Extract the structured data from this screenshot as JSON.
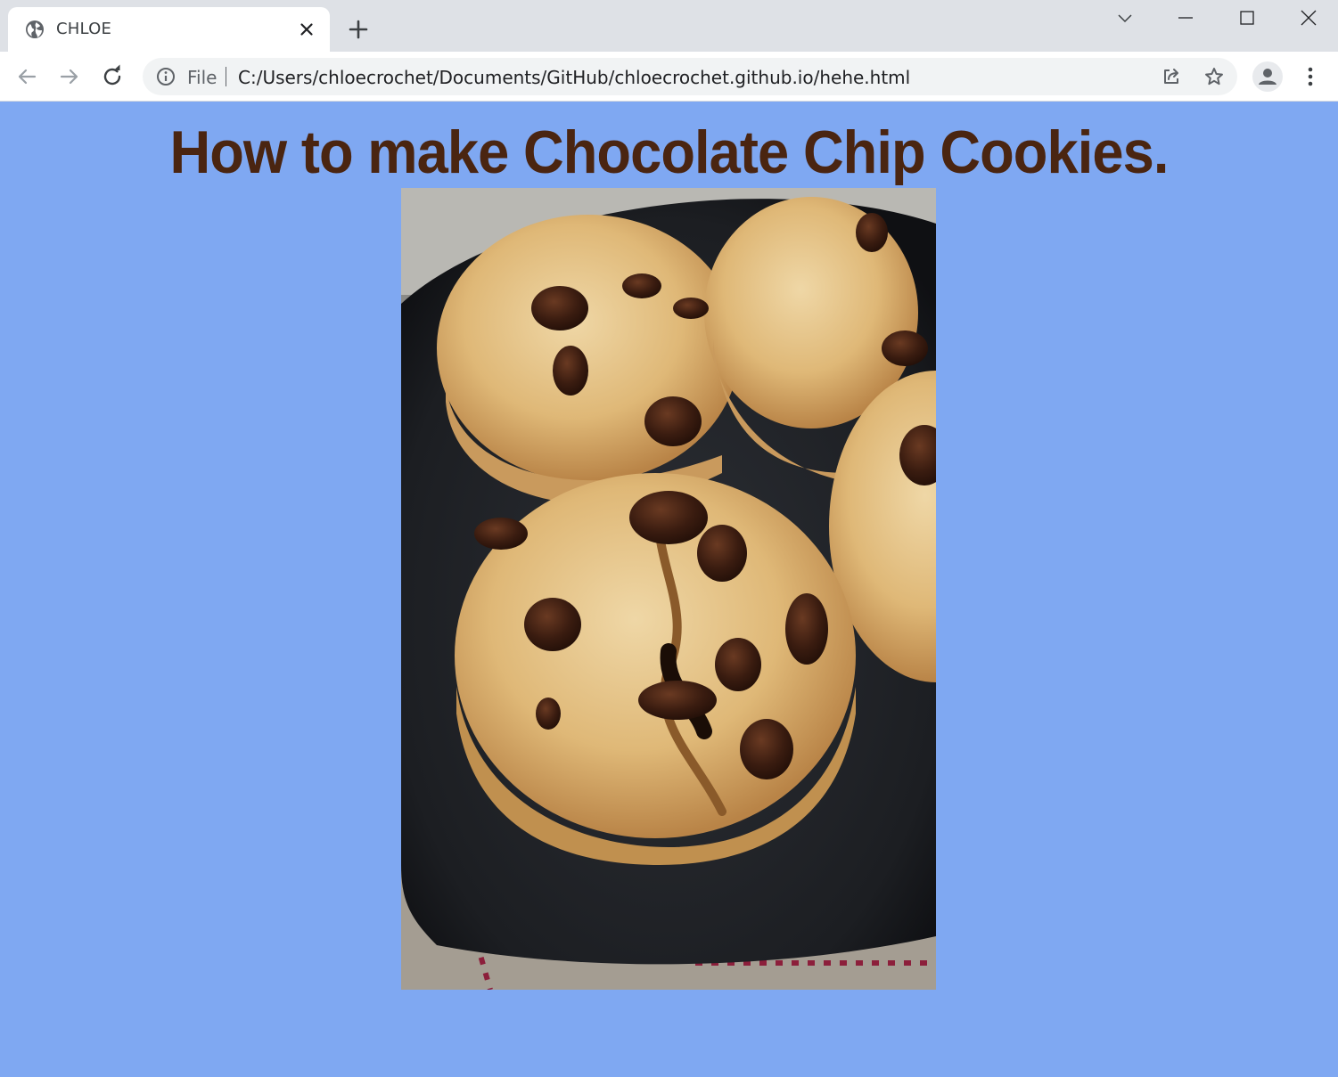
{
  "browser": {
    "tab": {
      "title": "CHLOE",
      "favicon": "globe-icon"
    },
    "omnibox": {
      "security_label": "File",
      "url": "C:/Users/chloecrochet/Documents/GitHub/chloecrochet.github.io/hehe.html"
    },
    "icons": {
      "back": "arrow-left-icon",
      "forward": "arrow-right-icon",
      "reload": "reload-icon",
      "share": "share-icon",
      "bookmark": "star-icon",
      "profile": "person-icon",
      "menu": "kebab-menu-icon",
      "tab_search": "chevron-down-icon",
      "minimize": "minimize-icon",
      "maximize": "maximize-icon",
      "close": "close-icon"
    }
  },
  "page": {
    "heading": "How to make Chocolate Chip Cookies.",
    "background_color": "#7fa8f2",
    "heading_color": "#4a2511",
    "image": {
      "subject": "chocolate chip cookies on a dark plate"
    }
  }
}
